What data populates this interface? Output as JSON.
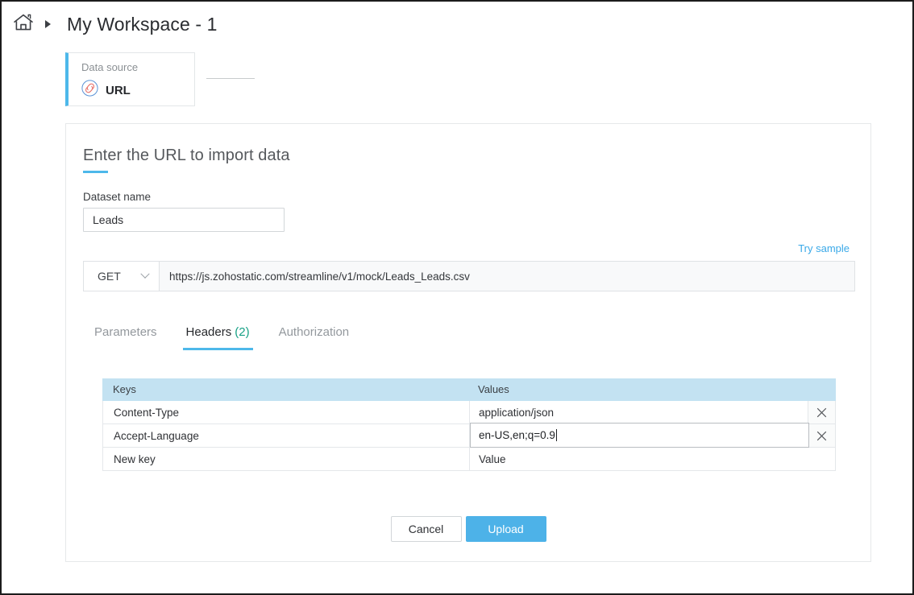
{
  "breadcrumb": {
    "home_icon": "home-icon",
    "separator_icon": "caret-right-icon",
    "title": "My Workspace - 1"
  },
  "data_source_card": {
    "label": "Data source",
    "icon": "link-icon",
    "value": "URL"
  },
  "panel": {
    "title": "Enter the URL to import data",
    "dataset": {
      "label": "Dataset name",
      "value": "Leads",
      "placeholder": "Dataset name"
    },
    "try_sample_label": "Try sample",
    "request": {
      "method": "GET",
      "method_caret_icon": "chevron-down-icon",
      "url": "https://js.zohostatic.com/streamline/v1/mock/Leads_Leads.csv",
      "url_placeholder": "Enter URL"
    },
    "tabs": [
      {
        "label": "Parameters",
        "count": "",
        "active": false
      },
      {
        "label": "Headers",
        "count": "(2)",
        "active": true
      },
      {
        "label": "Authorization",
        "count": "",
        "active": false
      }
    ],
    "headers_table": {
      "columns": [
        "Keys",
        "Values"
      ],
      "rows": [
        {
          "key": "Content-Type",
          "value": "application/json",
          "delete_icon": "close-icon",
          "focused": false
        },
        {
          "key": "Accept-Language",
          "value": "en-US,en;q=0.9",
          "delete_icon": "close-icon",
          "focused": true
        }
      ],
      "new_row": {
        "key_placeholder": "New key",
        "value_placeholder": "Value"
      }
    },
    "buttons": {
      "cancel": "Cancel",
      "upload": "Upload"
    }
  },
  "colors": {
    "accent_blue": "#4db8ea",
    "primary_button": "#4db2e8",
    "table_header": "#c3e2f2",
    "tab_count_green": "#16a085",
    "link_icon_red": "#e8736c"
  }
}
